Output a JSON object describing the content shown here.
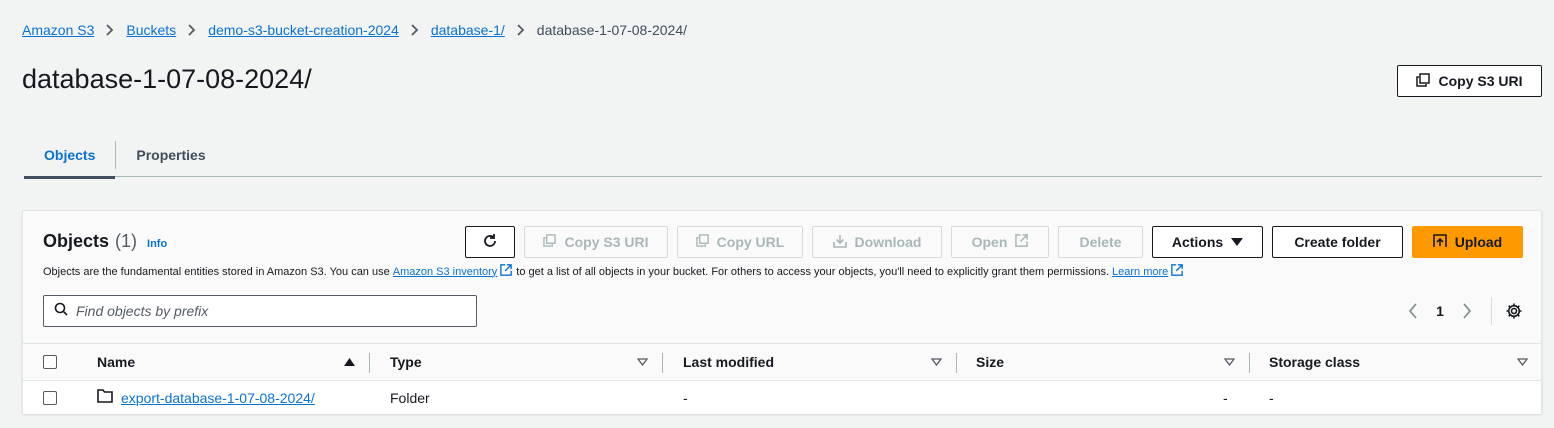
{
  "breadcrumb": {
    "items": [
      "Amazon S3",
      "Buckets",
      "demo-s3-bucket-creation-2024",
      "database-1/"
    ],
    "current": "database-1-07-08-2024/"
  },
  "page": {
    "title": "database-1-07-08-2024/",
    "copy_uri_label": "Copy S3 URI"
  },
  "tabs": [
    {
      "label": "Objects",
      "active": true
    },
    {
      "label": "Properties",
      "active": false
    }
  ],
  "objects_panel": {
    "title": "Objects",
    "count": "(1)",
    "info_label": "Info",
    "toolbar": {
      "copy_uri": "Copy S3 URI",
      "copy_url": "Copy URL",
      "download": "Download",
      "open": "Open",
      "delete": "Delete",
      "actions": "Actions",
      "create_folder": "Create folder",
      "upload": "Upload"
    },
    "description": {
      "before": "Objects are the fundamental entities stored in Amazon S3. You can use",
      "inventory_link": "Amazon S3 inventory",
      "middle": "to get a list of all objects in your bucket. For others to access your objects, you'll need to explicitly grant them permissions.",
      "learn_more": "Learn more"
    },
    "search_placeholder": "Find objects by prefix",
    "pagination": {
      "current_page": "1"
    }
  },
  "table": {
    "columns": [
      "Name",
      "Type",
      "Last modified",
      "Size",
      "Storage class"
    ],
    "sorted_column": "Name",
    "sort_direction": "ascending",
    "rows": [
      {
        "name": "export-database-1-07-08-2024/",
        "type": "Folder",
        "last_modified": "-",
        "size": "-",
        "storage_class": "-"
      }
    ]
  },
  "colors": {
    "link": "#0972d3",
    "primary_button": "#ff9900",
    "text": "#16191f",
    "background": "#f2f3f3"
  }
}
